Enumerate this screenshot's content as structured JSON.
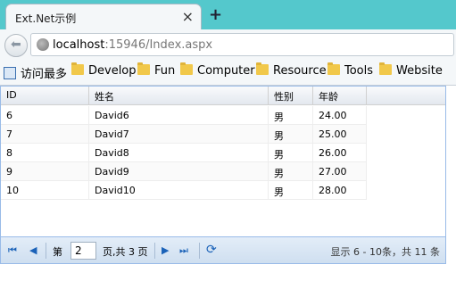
{
  "browser": {
    "tab_title": "Ext.Net示例",
    "tab_close": "×",
    "new_tab": "+",
    "url_host": "localhost",
    "url_rest": ":15946/Index.aspx"
  },
  "bookmarks": [
    "访问最多",
    "Develop",
    "Fun",
    "Computer",
    "Resource",
    "Tools",
    "Website"
  ],
  "grid": {
    "columns": [
      "ID",
      "姓名",
      "性别",
      "年龄"
    ],
    "rows": [
      {
        "id": "6",
        "name": "David6",
        "sex": "男",
        "age": "24.00"
      },
      {
        "id": "7",
        "name": "David7",
        "sex": "男",
        "age": "25.00"
      },
      {
        "id": "8",
        "name": "David8",
        "sex": "男",
        "age": "26.00"
      },
      {
        "id": "9",
        "name": "David9",
        "sex": "男",
        "age": "27.00"
      },
      {
        "id": "10",
        "name": "David10",
        "sex": "男",
        "age": "28.00"
      }
    ]
  },
  "pager": {
    "first_icon": "first-page-icon",
    "prev_icon": "prev-page-icon",
    "next_icon": "next-page-icon",
    "last_icon": "last-page-icon",
    "refresh_icon": "refresh-icon",
    "page_label": "第",
    "page_value": "2",
    "page_suffix": "页,共 3 页",
    "status": "显示 6 - 10条，共 11 条"
  }
}
